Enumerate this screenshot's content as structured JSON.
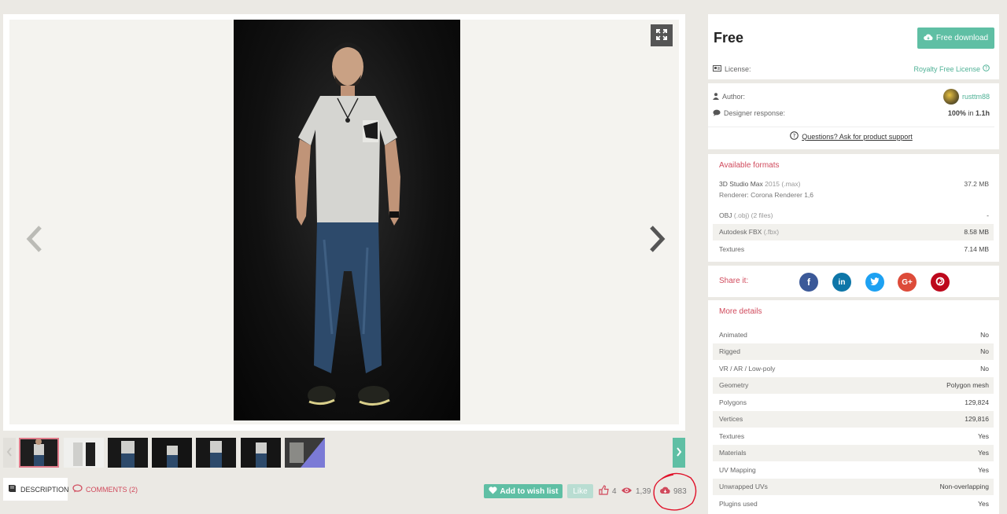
{
  "viewer": {
    "expand_icon": "expand-icon",
    "prev_icon": "chevron-left-icon",
    "next_icon": "chevron-right-icon"
  },
  "thumbnails": {
    "count": 7,
    "active_index": 0
  },
  "tabs": {
    "description": "DESCRIPTION",
    "comments": "COMMENTS (2)"
  },
  "actions": {
    "wish_label": "Add to wish list",
    "like_label": "Like",
    "likes": "4",
    "views": "1,39",
    "downloads": "983"
  },
  "price": {
    "label": "Free",
    "download_label": "Free download",
    "license_label": "License:",
    "license_value": "Royalty Free License"
  },
  "author": {
    "author_label": "Author:",
    "author_name": "rusttm88",
    "response_label": "Designer response:",
    "response_pct": "100%",
    "response_in": "in",
    "response_time": "1.1h",
    "support_link": "Questions? Ask for product support"
  },
  "formats": {
    "title": "Available formats",
    "items": [
      {
        "name": "3D Studio Max",
        "ver": "2015 (.max)",
        "renderer": "Renderer: Corona Renderer 1,6",
        "size": "37.2 MB"
      },
      {
        "name": "OBJ",
        "ver": "(.obj) (2 files)",
        "size": "-"
      },
      {
        "name": "Autodesk FBX",
        "ver": "(.fbx)",
        "size": "8.58 MB"
      },
      {
        "name": "Textures",
        "ver": "",
        "size": "7.14 MB"
      }
    ]
  },
  "share": {
    "label": "Share it:",
    "networks": [
      "facebook",
      "linkedin",
      "twitter",
      "google-plus",
      "pinterest"
    ],
    "colors": {
      "facebook": "#3b5998",
      "linkedin": "#0e76a8",
      "twitter": "#1da1f2",
      "google-plus": "#dd4b39",
      "pinterest": "#bd081c"
    }
  },
  "details": {
    "title": "More details",
    "rows": [
      {
        "k": "Animated",
        "v": "No"
      },
      {
        "k": "Rigged",
        "v": "No"
      },
      {
        "k": "VR / AR / Low-poly",
        "v": "No"
      },
      {
        "k": "Geometry",
        "v": "Polygon mesh"
      },
      {
        "k": "Polygons",
        "v": "129,824"
      },
      {
        "k": "Vertices",
        "v": "129,816"
      },
      {
        "k": "Textures",
        "v": "Yes"
      },
      {
        "k": "Materials",
        "v": "Yes"
      },
      {
        "k": "UV Mapping",
        "v": "Yes"
      },
      {
        "k": "Unwrapped UVs",
        "v": "Non-overlapping"
      },
      {
        "k": "Plugins used",
        "v": "Yes"
      }
    ]
  },
  "colors": {
    "accent": "#5fbfa4",
    "pink": "#d04a5c",
    "background": "#ebe9e4"
  }
}
